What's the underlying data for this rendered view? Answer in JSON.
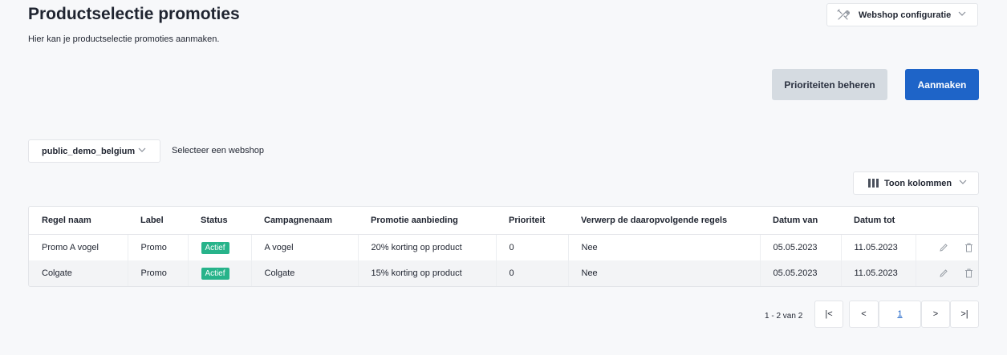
{
  "header": {
    "title": "Productselectie promoties",
    "subtitle": "Hier kan je productselectie promoties aanmaken."
  },
  "webshop_config": {
    "label": "Webshop configuratie",
    "icon": "tools-icon"
  },
  "actions": {
    "manage_priorities": "Prioriteiten beheren",
    "create": "Aanmaken"
  },
  "shop_select": {
    "value": "public_demo_belgium",
    "hint": "Selecteer een webshop"
  },
  "columns_button": {
    "label": "Toon kolommen"
  },
  "table": {
    "headers": [
      "Regel naam",
      "Label",
      "Status",
      "Campagnenaam",
      "Promotie aanbieding",
      "Prioriteit",
      "Verwerp de daaropvolgende regels",
      "Datum van",
      "Datum tot"
    ],
    "rows": [
      {
        "name": "Promo A vogel",
        "label": "Promo",
        "status": "Actief",
        "campaign": "A vogel",
        "offer": "20% korting op product",
        "priority": "0",
        "discard": "Nee",
        "from": "05.05.2023",
        "to": "11.05.2023"
      },
      {
        "name": "Colgate",
        "label": "Promo",
        "status": "Actief",
        "campaign": "Colgate",
        "offer": "15% korting op product",
        "priority": "0",
        "discard": "Nee",
        "from": "05.05.2023",
        "to": "11.05.2023"
      }
    ]
  },
  "pagination": {
    "info": "1 - 2 van 2",
    "current_page": "1",
    "first": "|<",
    "prev": "<",
    "next": ">",
    "last": ">|"
  },
  "colors": {
    "primary": "#1e64c8",
    "secondary": "#d5dbe1",
    "status_active": "#27b38a",
    "background": "#f7f8fa"
  }
}
